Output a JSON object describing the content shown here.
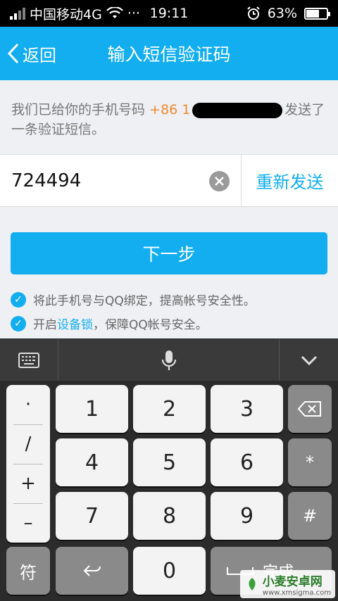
{
  "status_bar": {
    "carrier": "中国移动4G",
    "dots": "···",
    "time": "19:11",
    "battery": "63%",
    "battery_level": 0.63,
    "icons": [
      "signal-icon",
      "wifi-icon",
      "alarm-icon",
      "battery-icon"
    ]
  },
  "header": {
    "back_label": "返回",
    "title": "输入短信验证码"
  },
  "info": {
    "text_before": "我们已给你的手机号码",
    "country_code": "+86 1",
    "text_after": "发送了一条验证短信。"
  },
  "verification": {
    "code_value": "724494",
    "resend_label": "重新发送"
  },
  "next_button": "下一步",
  "options": [
    {
      "label": "将此手机号与QQ绑定，提高帐号安全性。"
    },
    {
      "before": "开启",
      "link": "设备锁",
      "after": "，保障QQ帐号安全。"
    }
  ],
  "keyboard": {
    "symbols": [
      "·",
      "/",
      "+",
      "–"
    ],
    "digits": [
      "1",
      "2",
      "3",
      "4",
      "5",
      "6",
      "7",
      "8",
      "9",
      "0"
    ],
    "star": "*",
    "hash": "#",
    "symbol_key": "符",
    "done_label": "完成"
  },
  "watermark": {
    "site": "小麦安卓网",
    "url": "www.xmsigma.com"
  },
  "colors": {
    "accent": "#12aef0",
    "country_code": "#f08a2e",
    "keyboard_bg": "#2b2b2b"
  }
}
